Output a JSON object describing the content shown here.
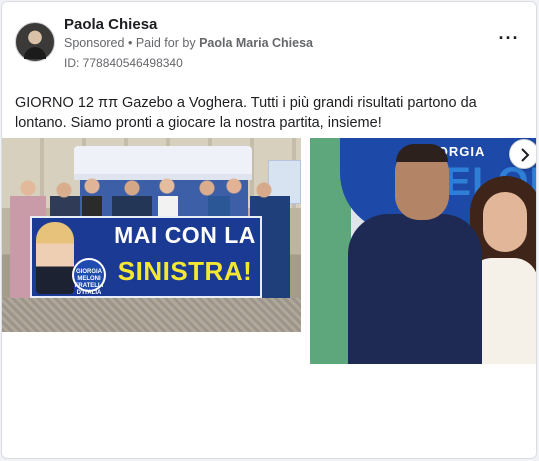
{
  "post": {
    "author_name": "Paola Chiesa",
    "sponsored_label": "Sponsored",
    "paid_for_prefix": "Paid for by",
    "paid_for_name": "Paola Maria Chiesa",
    "ad_id": "ID: 778840546498340",
    "more_icon": "more-horizontal-icon",
    "text": "GIORNO 12 ππ Gazebo a Voghera. Tutti i più grandi risultati partono da lontano. Siamo pronti a giocare la nostra partita, insieme!"
  },
  "carousel": {
    "card1": {
      "banner_line1": "MAI CON LA",
      "banner_line2": "SINISTRA!",
      "logo_text": "GIORGIA MELONI FRATELLI D'ITALIA"
    },
    "card2": {
      "flag_line1": "GIORGIA",
      "flag_line2": "MELONI"
    },
    "next_icon": "chevron-right-icon"
  },
  "colors": {
    "banner_blue": "#1b3a93",
    "banner_yellow": "#f4e733",
    "meta_gray": "#65676b"
  }
}
